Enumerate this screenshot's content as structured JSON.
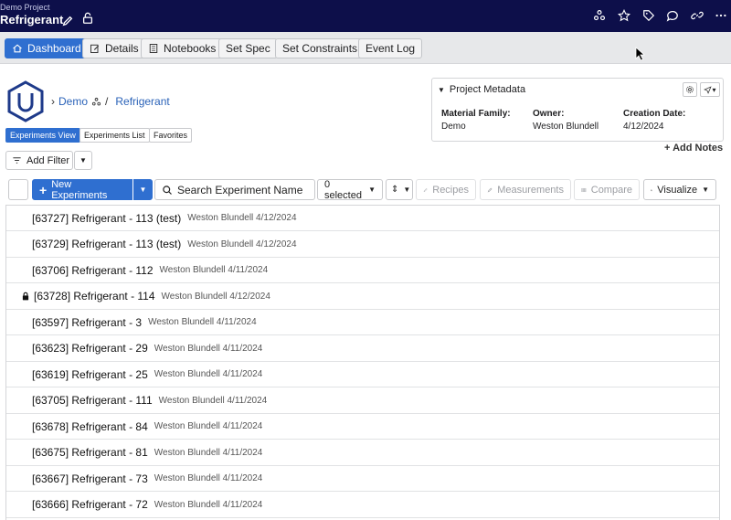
{
  "header": {
    "project_label": "Demo Project",
    "title": "Refrigerant",
    "icons": [
      "edit-icon",
      "unlock-icon",
      "network-icon",
      "star-icon",
      "tag-icon",
      "comment-icon",
      "link-icon",
      "more-icon"
    ]
  },
  "nav": {
    "tabs": [
      {
        "label": "Dashboard",
        "icon": "home-icon",
        "active": true
      },
      {
        "label": "Details",
        "icon": "edit-icon"
      },
      {
        "label": "Notebooks",
        "icon": "notebook-icon"
      },
      {
        "label": "Set Spec"
      },
      {
        "label": "Set Constraints"
      },
      {
        "label": "Event Log"
      }
    ]
  },
  "breadcrumb": {
    "root": "Demo",
    "sep": "/",
    "current": "Refrigerant"
  },
  "views": {
    "experiments_view": "Experiments View",
    "experiments_list": "Experiments List",
    "favorites": "Favorites"
  },
  "metadata": {
    "title": "Project Metadata",
    "material_family_label": "Material Family:",
    "material_family": "Demo",
    "owner_label": "Owner:",
    "owner": "Weston Blundell",
    "creation_date_label": "Creation Date:",
    "creation_date": "4/12/2024",
    "add_notes": "+ Add Notes"
  },
  "filter": {
    "label": "Add Filter"
  },
  "toolbar": {
    "new_experiments": "New Experiments",
    "search_placeholder": "Search Experiment Name",
    "selected": "0 selected",
    "recipes": "Recipes",
    "measurements": "Measurements",
    "compare": "Compare",
    "visualize": "Visualize"
  },
  "experiments": [
    {
      "name": "[63727] Refrigerant  - 113 (test)",
      "meta": "Weston Blundell 4/12/2024",
      "locked": false
    },
    {
      "name": "[63729] Refrigerant  - 113 (test)",
      "meta": "Weston Blundell 4/12/2024",
      "locked": false
    },
    {
      "name": "[63706] Refrigerant  - 112",
      "meta": "Weston Blundell 4/11/2024",
      "locked": false
    },
    {
      "name": "[63728] Refrigerant  - 114",
      "meta": "Weston Blundell 4/12/2024",
      "locked": true
    },
    {
      "name": "[63597] Refrigerant  - 3",
      "meta": "Weston Blundell 4/11/2024",
      "locked": false
    },
    {
      "name": "[63623] Refrigerant  - 29",
      "meta": "Weston Blundell 4/11/2024",
      "locked": false
    },
    {
      "name": "[63619] Refrigerant  - 25",
      "meta": "Weston Blundell 4/11/2024",
      "locked": false
    },
    {
      "name": "[63705] Refrigerant  - 111",
      "meta": "Weston Blundell 4/11/2024",
      "locked": false
    },
    {
      "name": "[63678] Refrigerant  - 84",
      "meta": "Weston Blundell 4/11/2024",
      "locked": false
    },
    {
      "name": "[63675] Refrigerant  - 81",
      "meta": "Weston Blundell 4/11/2024",
      "locked": false
    },
    {
      "name": "[63667] Refrigerant  - 73",
      "meta": "Weston Blundell 4/11/2024",
      "locked": false
    },
    {
      "name": "[63666] Refrigerant  - 72",
      "meta": "Weston Blundell 4/11/2024",
      "locked": false
    }
  ],
  "colors": {
    "topbar": "#0d0f4a",
    "accent": "#2f6fd0",
    "logo": "#1e3a8a"
  }
}
